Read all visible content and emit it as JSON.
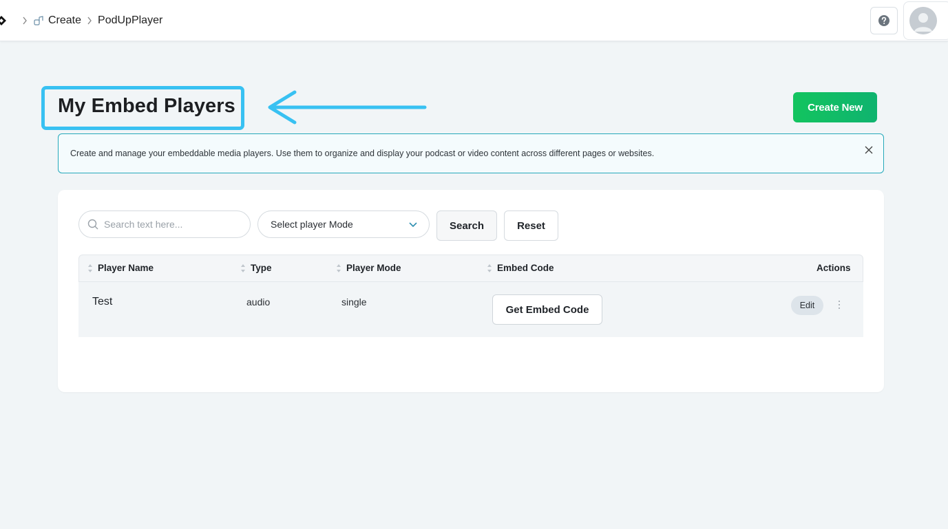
{
  "breadcrumb": {
    "items": [
      "Create",
      "PodUpPlayer"
    ]
  },
  "header": {
    "help_icon": "question-circle-icon",
    "avatar_icon": "user-avatar-icon"
  },
  "page": {
    "title": "My Embed Players",
    "create_button_label": "Create New",
    "info_banner": "Create and manage your embeddable media players. Use them to organize and display your podcast or video content across different pages or websites."
  },
  "filters": {
    "search_placeholder": "Search text here...",
    "mode_select_value": "Select player Mode",
    "search_button_label": "Search",
    "reset_button_label": "Reset"
  },
  "table": {
    "columns": [
      "Player Name",
      "Type",
      "Player Mode",
      "Embed Code",
      "Actions"
    ],
    "rows": [
      {
        "name": "Test",
        "type": "audio",
        "mode": "single",
        "embed_button_label": "Get Embed Code",
        "edit_label": "Edit"
      }
    ]
  },
  "colors": {
    "accent_highlight": "#38c1f2",
    "create_button": "#13c45f",
    "banner_border": "#24a8ba"
  }
}
